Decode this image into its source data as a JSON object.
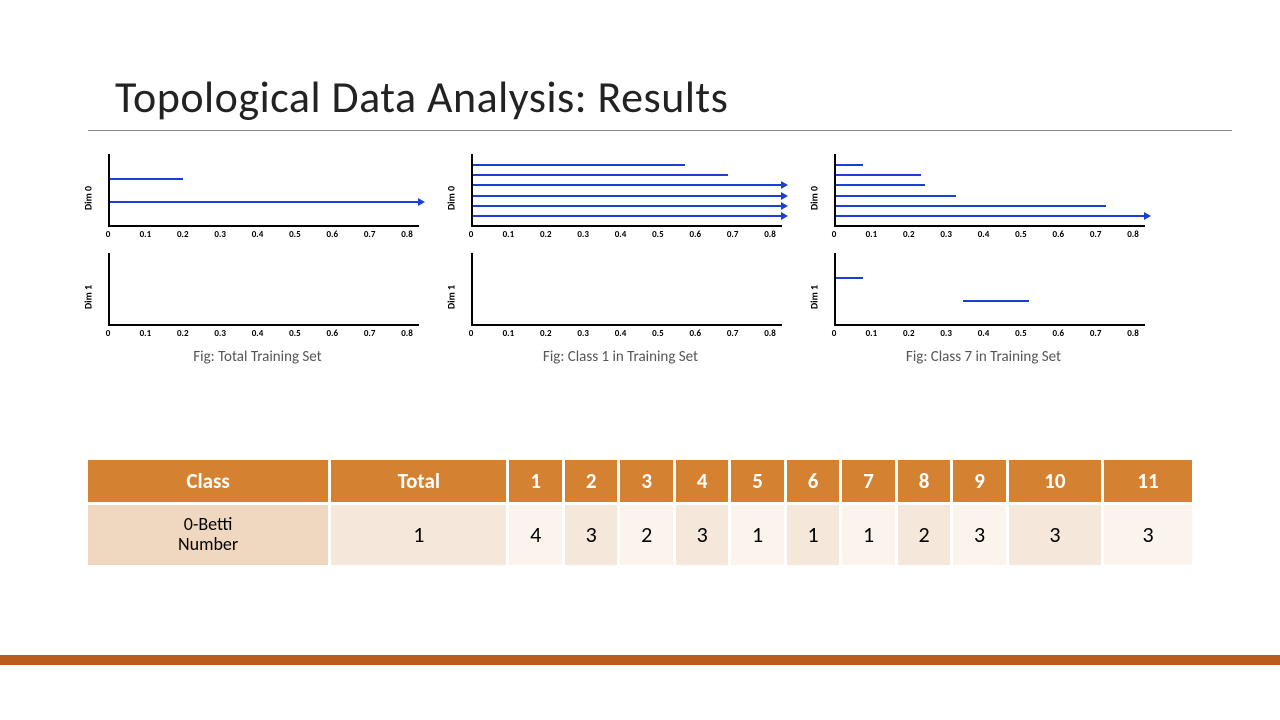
{
  "title": "Topological Data Analysis: Results",
  "xticks": [
    "0",
    "0.1",
    "0.2",
    "0.3",
    "0.4",
    "0.5",
    "0.6",
    "0.7",
    "0.8"
  ],
  "captions": {
    "c0": "Fig: Total Training Set",
    "c1": "Fig: Class 1 in Training Set",
    "c2": "Fig: Class 7 in Training Set"
  },
  "table": {
    "header": [
      "Class",
      "Total",
      "1",
      "2",
      "3",
      "4",
      "5",
      "6",
      "7",
      "8",
      "9",
      "10",
      "11"
    ],
    "rowlabel": "0-Betti Number",
    "values": [
      "1",
      "4",
      "3",
      "2",
      "3",
      "1",
      "1",
      "1",
      "2",
      "3",
      "3",
      "3"
    ]
  },
  "chart_data": [
    {
      "type": "barcode",
      "caption": "Total Training Set — Dim 0",
      "ylabel": "Dim 0",
      "xlim": [
        0,
        0.8
      ],
      "bars": [
        {
          "start": 0,
          "end": 0.19,
          "arrow": false
        },
        {
          "start": 0,
          "end": 0.8,
          "arrow": true
        }
      ]
    },
    {
      "type": "barcode",
      "caption": "Total Training Set — Dim 1",
      "ylabel": "Dim 1",
      "xlim": [
        0,
        0.8
      ],
      "bars": []
    },
    {
      "type": "barcode",
      "caption": "Class 1 — Dim 0",
      "ylabel": "Dim 0",
      "xlim": [
        0,
        0.8
      ],
      "bars": [
        {
          "start": 0,
          "end": 0.55,
          "arrow": false
        },
        {
          "start": 0,
          "end": 0.66,
          "arrow": false
        },
        {
          "start": 0,
          "end": 0.8,
          "arrow": true
        },
        {
          "start": 0,
          "end": 0.8,
          "arrow": true
        },
        {
          "start": 0,
          "end": 0.8,
          "arrow": true
        },
        {
          "start": 0,
          "end": 0.8,
          "arrow": true
        }
      ]
    },
    {
      "type": "barcode",
      "caption": "Class 1 — Dim 1",
      "ylabel": "Dim 1",
      "xlim": [
        0,
        0.8
      ],
      "bars": []
    },
    {
      "type": "barcode",
      "caption": "Class 7 — Dim 0",
      "ylabel": "Dim 0",
      "xlim": [
        0,
        0.8
      ],
      "bars": [
        {
          "start": 0,
          "end": 0.07,
          "arrow": false
        },
        {
          "start": 0,
          "end": 0.22,
          "arrow": false
        },
        {
          "start": 0,
          "end": 0.23,
          "arrow": false
        },
        {
          "start": 0,
          "end": 0.31,
          "arrow": false
        },
        {
          "start": 0,
          "end": 0.7,
          "arrow": false
        },
        {
          "start": 0,
          "end": 0.8,
          "arrow": true
        }
      ]
    },
    {
      "type": "barcode",
      "caption": "Class 7 — Dim 1",
      "ylabel": "Dim 1",
      "xlim": [
        0,
        0.8
      ],
      "bars": [
        {
          "start": 0,
          "end": 0.07,
          "arrow": false
        },
        {
          "start": 0.33,
          "end": 0.5,
          "arrow": false
        }
      ]
    }
  ]
}
